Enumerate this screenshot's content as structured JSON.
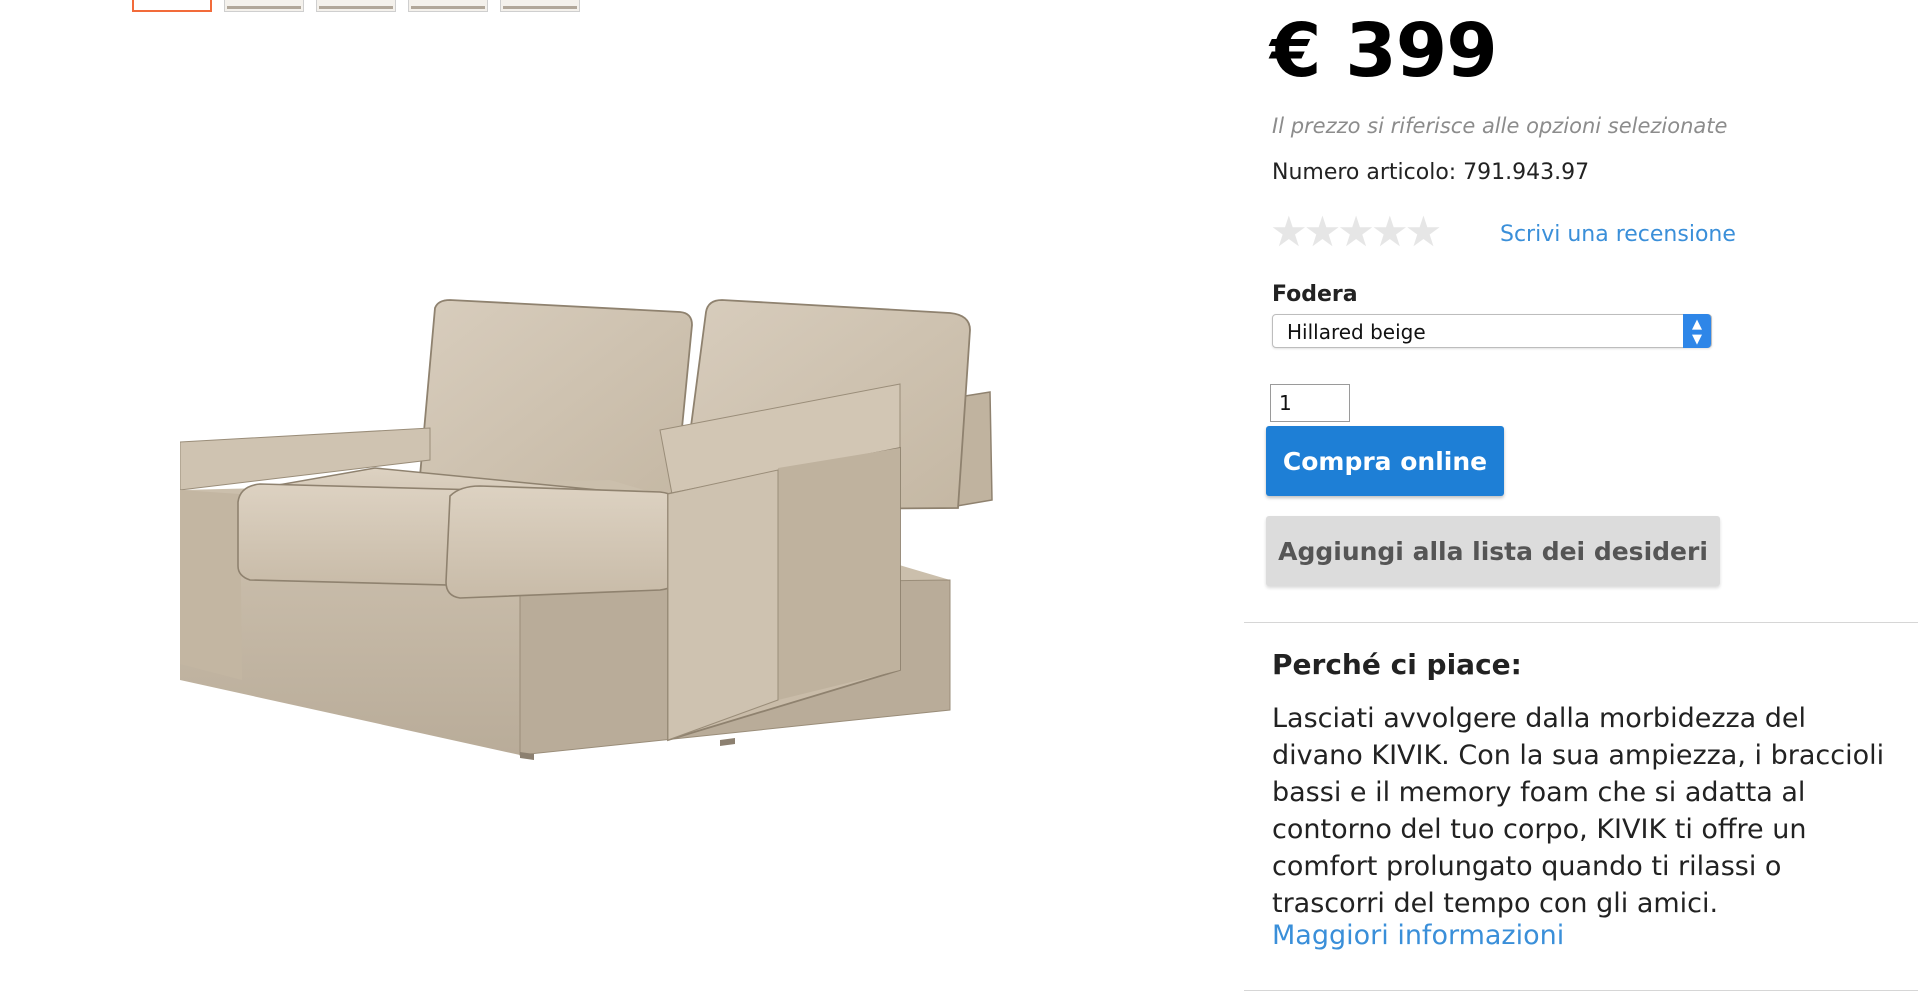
{
  "gallery": {
    "thumbnail_count": 5,
    "active_index": 0,
    "active_color": "#f26b3a"
  },
  "product": {
    "price": "€ 399",
    "price_note": "Il prezzo si riferisce alle opzioni selezionate",
    "article_number": "Numero articolo: 791.943.97",
    "rating_stars": "★★★★★",
    "rating_value": 0,
    "review_link": "Scrivi una recensione",
    "cover_label": "Fodera",
    "cover_selected": "Hillared beige",
    "quantity": "1",
    "buy_button": "Compra online",
    "wishlist_button": "Aggiungi alla lista dei desideri"
  },
  "why": {
    "title": "Perché ci piace:",
    "text": "Lasciati avvolgere dalla morbidezza del divano KIVIK. Con la sua ampiezza, i braccioli bassi e il memory foam che si adatta al contorno del tuo corpo, KIVIK ti offre un comfort prolungato quando ti rilassi o trascorri del tempo con gli amici.",
    "more_link": "Maggiori informazioni"
  },
  "colors": {
    "link": "#3a8fd9",
    "primary_button": "#1e7fd6",
    "disabled_button": "#dcdcdc",
    "sofa_fabric": "#d6cab8"
  }
}
